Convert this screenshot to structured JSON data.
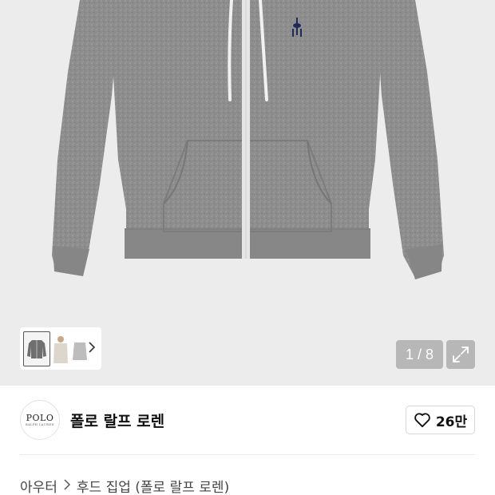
{
  "gallery": {
    "counter": "1 / 8",
    "thumbnails": [
      {
        "icon": "gray-hoodie-thumb",
        "active": true
      },
      {
        "icon": "beige-hoodie-thumb",
        "active": false
      },
      {
        "icon": "light-gray-hoodie-thumb",
        "active": false
      }
    ],
    "next_icon": "chevron-right-icon",
    "expand_icon": "expand-icon"
  },
  "brand": {
    "logo_text": "POLO",
    "logo_subtext": "RALPH LAUREN",
    "name": "폴로 랄프 로렌"
  },
  "like": {
    "icon": "heart-icon",
    "count": "26만"
  },
  "breadcrumb": {
    "category": "아우터",
    "separator_icon": "chevron-right-icon",
    "subcategory": "후드 집업 (폴로 랄프 로렌)"
  },
  "colors": {
    "gallery_bg": "#ececec",
    "hoodie": "#8f8f8f",
    "logo_embroidery": "#1f2a5a",
    "counter_bg": "#9a9a9a"
  }
}
